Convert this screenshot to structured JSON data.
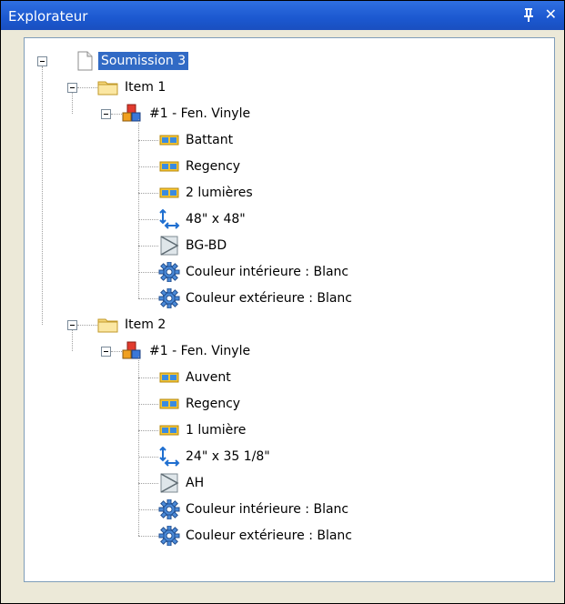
{
  "window": {
    "title": "Explorateur",
    "close_glyph": "✕"
  },
  "colors": {
    "titlebar": "#1b58d0",
    "selection": "#316ac5"
  },
  "tree": {
    "root": {
      "label": "Soumission 3",
      "icon": "document-icon"
    },
    "items": [
      {
        "label": "Item 1",
        "product": "#1 - Fen. Vinyle",
        "attributes": [
          {
            "icon": "window-type-icon",
            "label": "Battant"
          },
          {
            "icon": "window-type-icon",
            "label": "Regency"
          },
          {
            "icon": "window-type-icon",
            "label": "2 lumières"
          },
          {
            "icon": "dimensions-icon",
            "label": "48\" x 48\""
          },
          {
            "icon": "hinge-icon",
            "label": "BG-BD"
          },
          {
            "icon": "gear-icon",
            "label": "Couleur intérieure : Blanc"
          },
          {
            "icon": "gear-icon",
            "label": "Couleur extérieure : Blanc"
          }
        ]
      },
      {
        "label": "Item 2",
        "product": "#1 - Fen. Vinyle",
        "attributes": [
          {
            "icon": "window-type-icon",
            "label": "Auvent"
          },
          {
            "icon": "window-type-icon",
            "label": "Regency"
          },
          {
            "icon": "window-type-icon",
            "label": "1 lumière"
          },
          {
            "icon": "dimensions-icon",
            "label": "24\" x 35 1/8\""
          },
          {
            "icon": "hinge-icon",
            "label": "AH"
          },
          {
            "icon": "gear-icon",
            "label": "Couleur intérieure : Blanc"
          },
          {
            "icon": "gear-icon",
            "label": "Couleur extérieure : Blanc"
          }
        ]
      }
    ]
  }
}
